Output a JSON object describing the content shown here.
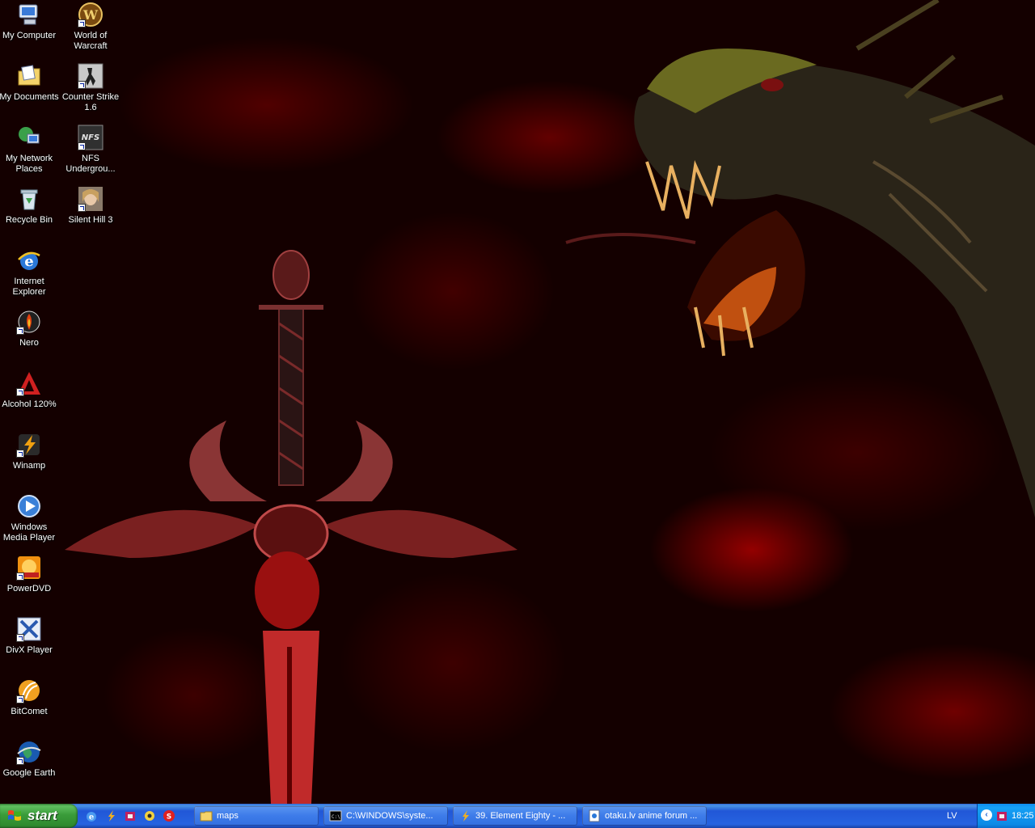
{
  "desktop": {
    "icons": [
      {
        "label": "My Computer",
        "icon": "my-computer-icon"
      },
      {
        "label": "World of Warcraft",
        "icon": "world-of-warcraft-icon"
      },
      {
        "label": "My Documents",
        "icon": "my-documents-icon"
      },
      {
        "label": "Counter Strike 1.6",
        "icon": "counter-strike-icon"
      },
      {
        "label": "My Network Places",
        "icon": "network-places-icon"
      },
      {
        "label": "NFS Undergrou...",
        "icon": "nfs-underground-icon"
      },
      {
        "label": "Recycle Bin",
        "icon": "recycle-bin-icon"
      },
      {
        "label": "Silent Hill 3",
        "icon": "silent-hill-icon"
      },
      {
        "label": "Internet Explorer",
        "icon": "internet-explorer-icon"
      },
      {
        "label": "Nero",
        "icon": "nero-icon"
      },
      {
        "label": "Alcohol 120%",
        "icon": "alcohol-icon"
      },
      {
        "label": "Winamp",
        "icon": "winamp-icon"
      },
      {
        "label": "Windows Media Player",
        "icon": "windows-media-player-icon"
      },
      {
        "label": "PowerDVD",
        "icon": "powerdvd-icon"
      },
      {
        "label": "DivX Player",
        "icon": "divx-player-icon"
      },
      {
        "label": "BitComet",
        "icon": "bitcomet-icon"
      },
      {
        "label": "Google Earth",
        "icon": "google-earth-icon"
      }
    ],
    "wallpaper": "red dragon and sword"
  },
  "taskbar": {
    "start_label": "start",
    "quick_launch": [
      {
        "icon": "internet-explorer-icon"
      },
      {
        "icon": "winamp-icon"
      },
      {
        "icon": "tray-app-icon"
      },
      {
        "icon": "media-icon"
      },
      {
        "icon": "skype-icon"
      }
    ],
    "tasks": [
      {
        "label": "maps",
        "icon": "folder-icon"
      },
      {
        "label": "C:\\WINDOWS\\syste...",
        "icon": "command-prompt-icon"
      },
      {
        "label": "39. Element Eighty - ...",
        "icon": "winamp-icon"
      },
      {
        "label": "otaku.lv anime forum ...",
        "icon": "browser-page-icon"
      }
    ],
    "tray": {
      "language": "LV",
      "time": "18:25"
    }
  },
  "colors": {
    "taskbar_blue": "#2663e0",
    "start_green": "#3a9c3a",
    "tray_blue": "#0c8ae6",
    "wallpaper_red": "#aa0000"
  }
}
